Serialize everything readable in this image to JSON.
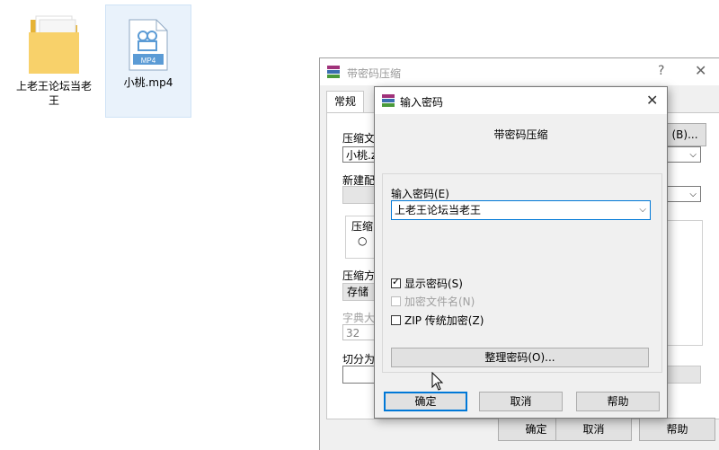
{
  "desktop": {
    "folder_label": "上老王论坛当老王",
    "file_label": "小桃.mp4",
    "file_badge": "MP4"
  },
  "back_dialog": {
    "title": "带密码压缩",
    "help_glyph": "?",
    "close_glyph": "✕",
    "tab_general": "常规",
    "archive_name_label": "压缩文",
    "archive_name_value": "小桃.z",
    "browse_button": "(B)...",
    "profile_label": "新建配",
    "format_label": "压缩",
    "radio_partial": "",
    "method_label": "压缩方",
    "method_value": "存储",
    "dict_label": "字典大",
    "dict_value": "32",
    "split_label": "切分为",
    "ok_button": "确定",
    "cancel_button": "取消",
    "help_button": "帮助"
  },
  "password_dialog": {
    "title": "输入密码",
    "close_glyph": "✕",
    "subtitle": "带密码压缩",
    "password_label": "输入密码(E)",
    "password_value": "上老王论坛当老王",
    "show_password": "显示密码(S)",
    "encrypt_filenames": "加密文件名(N)",
    "zip_legacy": "ZIP 传统加密(Z)",
    "manage_button": "整理密码(O)...",
    "ok_button": "确定",
    "cancel_button": "取消",
    "help_button": "帮助",
    "show_password_checked": true,
    "encrypt_filenames_checked": false,
    "zip_legacy_checked": false
  },
  "colors": {
    "accent": "#0078d7",
    "folder": "#f5c542",
    "mp4_badge": "#5b9bd5"
  }
}
